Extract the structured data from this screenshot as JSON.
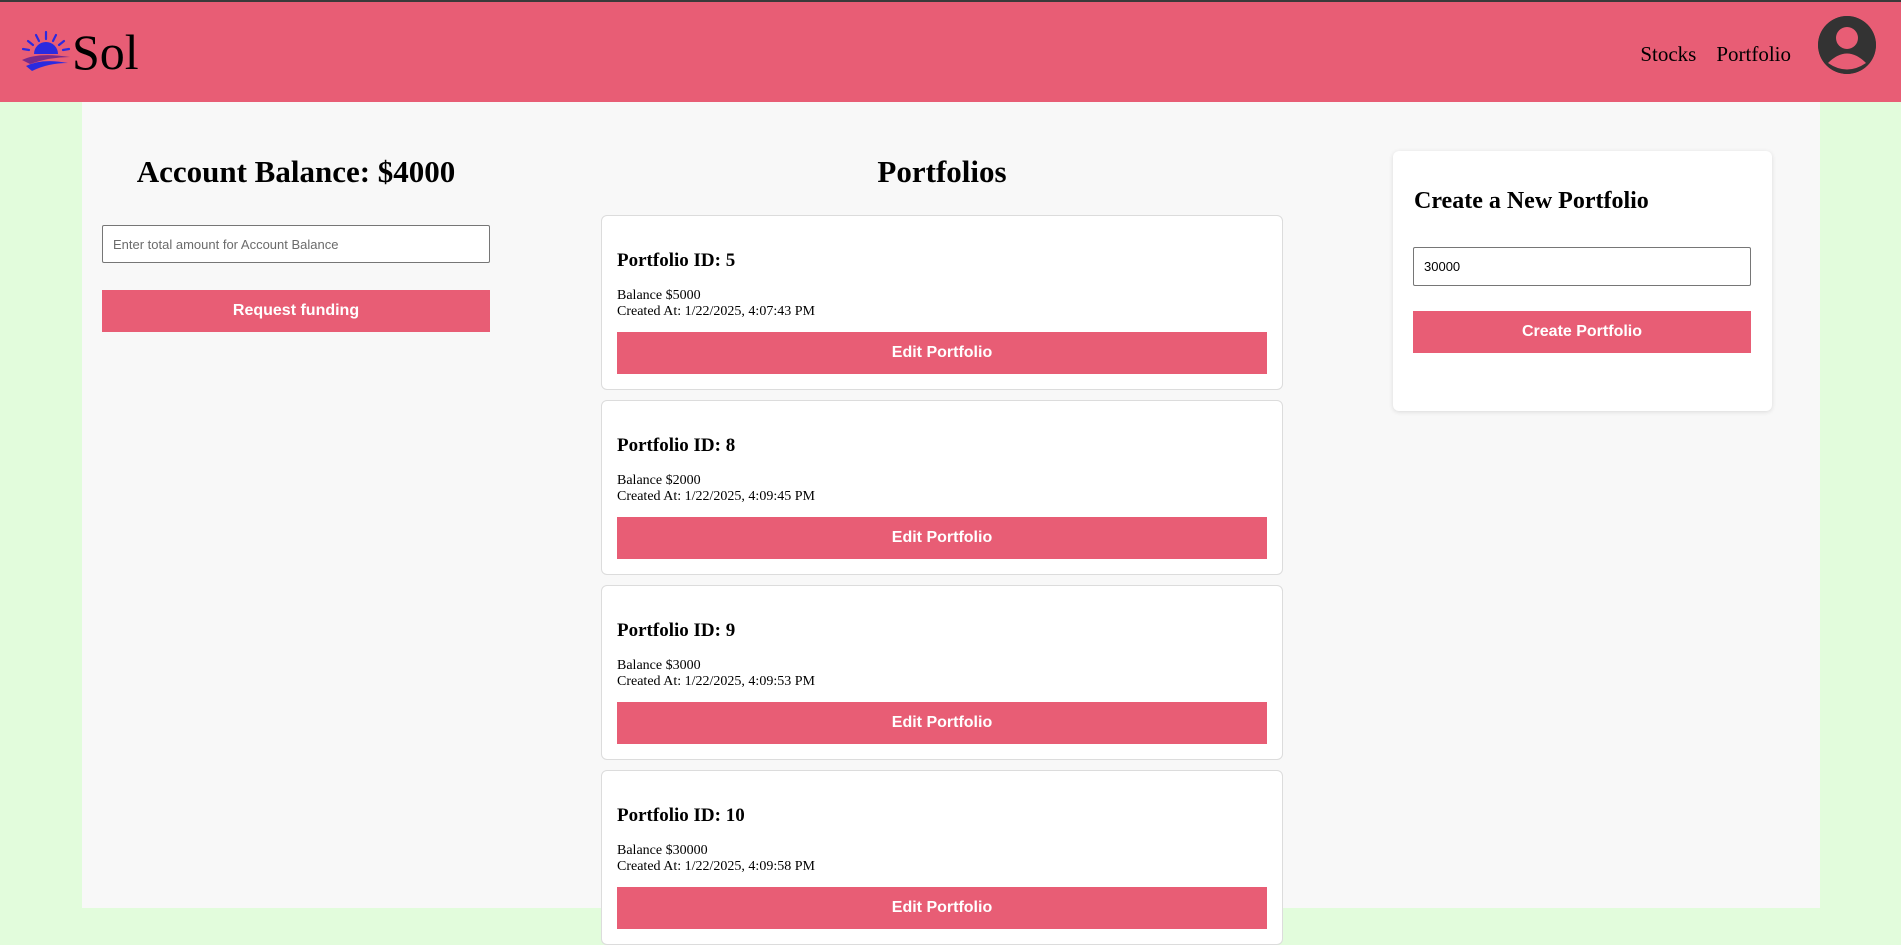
{
  "header": {
    "brand": "Sol",
    "nav": [
      "Stocks",
      "Portfolio"
    ]
  },
  "account": {
    "title": "Account Balance: $4000",
    "input_placeholder": "Enter total amount for Account Balance",
    "request_button": "Request funding"
  },
  "portfolios": {
    "title": "Portfolios",
    "items": [
      {
        "title": "Portfolio ID: 5",
        "balance": "Balance $5000",
        "created": "Created At: 1/22/2025, 4:07:43 PM",
        "button": "Edit Portfolio"
      },
      {
        "title": "Portfolio ID: 8",
        "balance": "Balance $2000",
        "created": "Created At: 1/22/2025, 4:09:45 PM",
        "button": "Edit Portfolio"
      },
      {
        "title": "Portfolio ID: 9",
        "balance": "Balance $3000",
        "created": "Created At: 1/22/2025, 4:09:53 PM",
        "button": "Edit Portfolio"
      },
      {
        "title": "Portfolio ID: 10",
        "balance": "Balance $30000",
        "created": "Created At: 1/22/2025, 4:09:58 PM",
        "button": "Edit Portfolio"
      }
    ]
  },
  "create": {
    "title": "Create a New Portfolio",
    "input_value": "30000",
    "button": "Create Portfolio"
  },
  "colors": {
    "navbar": "#e85d75",
    "accent": "#e85d75",
    "page_bg": "#e2fcdc",
    "content_bg": "#f8f8f8"
  },
  "icons": [
    "sunrise-logo-icon",
    "user-avatar-icon"
  ]
}
